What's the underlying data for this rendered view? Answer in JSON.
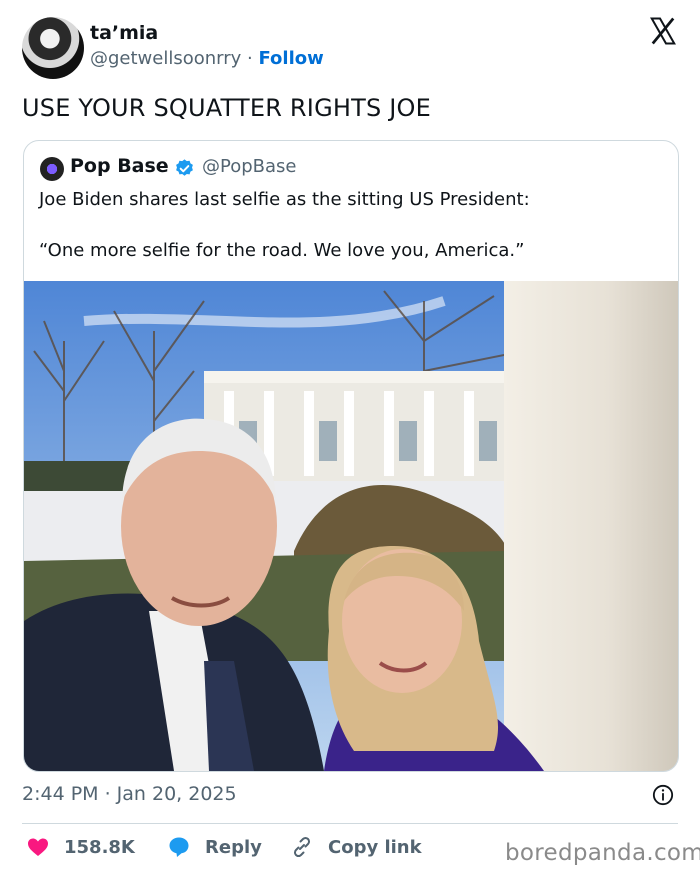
{
  "author": {
    "name": "ta’mia",
    "handle": "@getwellsoonrry",
    "separator": " · ",
    "follow_label": "Follow",
    "avatar_icon": "profile-avatar"
  },
  "platform_icon": "x-logo-icon",
  "tweet": {
    "text": "USE YOUR SQUATTER RIGHTS JOE"
  },
  "quoted": {
    "name": "Pop Base",
    "verified_icon": "verified-badge-icon",
    "handle": "@PopBase",
    "line1": "Joe Biden shares last selfie as the sitting US President:",
    "line2": "“One more selfie for the road. We love you, America.”"
  },
  "meta": {
    "timestamp": "2:44 PM · Jan 20, 2025"
  },
  "actions": {
    "likes": "158.8K",
    "reply_label": "Reply",
    "copy_label": "Copy link"
  },
  "watermark": "boredpanda.com",
  "colors": {
    "accent": "#006fd6",
    "like": "#f91880",
    "reply": "#1d9bf0",
    "muted": "#536471"
  }
}
